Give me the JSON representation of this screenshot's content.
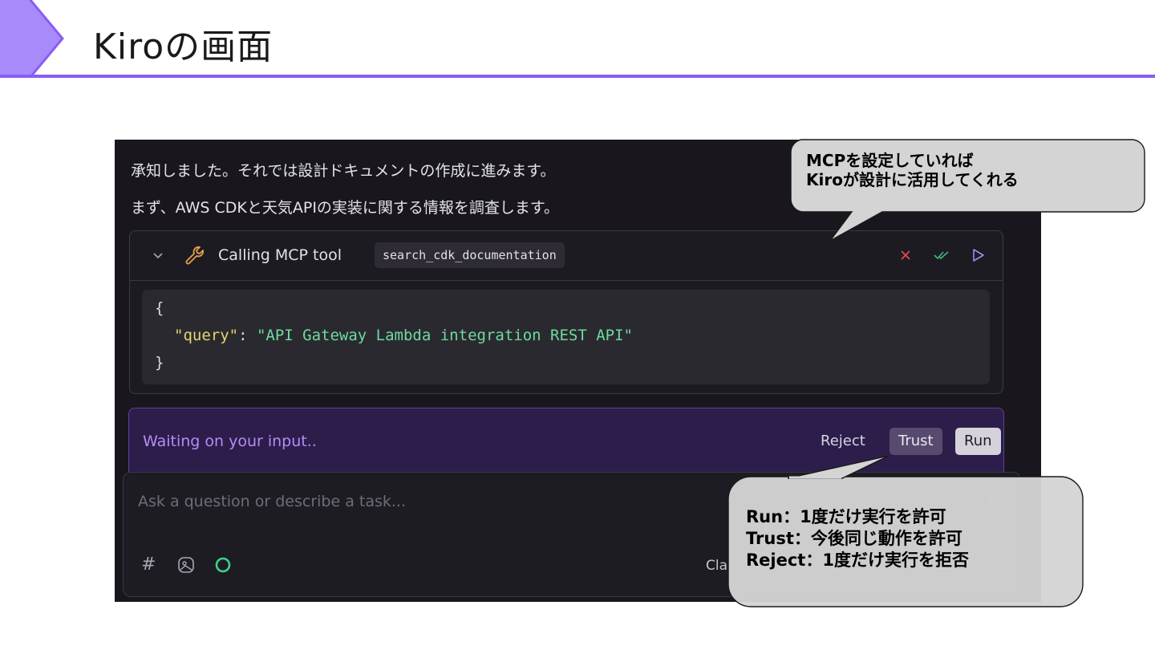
{
  "slide": {
    "title": "Kiroの画面",
    "accent_color": "#8b5cf6"
  },
  "chat": {
    "message_line_1": "承知しました。それでは設計ドキュメントの作成に進みます。",
    "message_line_2": "まず、AWS CDKと天気APIの実装に関する情報を調査します。"
  },
  "tool_call": {
    "label": "Calling MCP tool",
    "tool_name": "search_cdk_documentation",
    "icons": [
      "chevron-down-icon",
      "wrench-icon",
      "close-icon",
      "double-check-icon",
      "play-icon"
    ],
    "code": {
      "open_brace": "{",
      "key": "\"query\"",
      "colon": ": ",
      "value": "\"API Gateway Lambda integration REST API\"",
      "close_brace": "}"
    }
  },
  "approval": {
    "waiting_text": "Waiting on your input..",
    "reject_label": "Reject",
    "trust_label": "Trust",
    "run_label": "Run"
  },
  "input": {
    "placeholder": "Ask a question or describe a task...",
    "hash_symbol": "#",
    "model_text": "Cla",
    "tool_icons": [
      "hash-icon",
      "image-icon",
      "status-ring-icon",
      "send-arrow-icon"
    ]
  },
  "callouts": {
    "mcp_note_line_1": "MCPを設定していれば",
    "mcp_note_line_2": "Kiroが設計に活用してくれる",
    "run_note": "Run：1度だけ実行を許可",
    "trust_note": "Trust：今後同じ動作を許可",
    "reject_note": "Reject：1度だけ実行を拒否"
  }
}
